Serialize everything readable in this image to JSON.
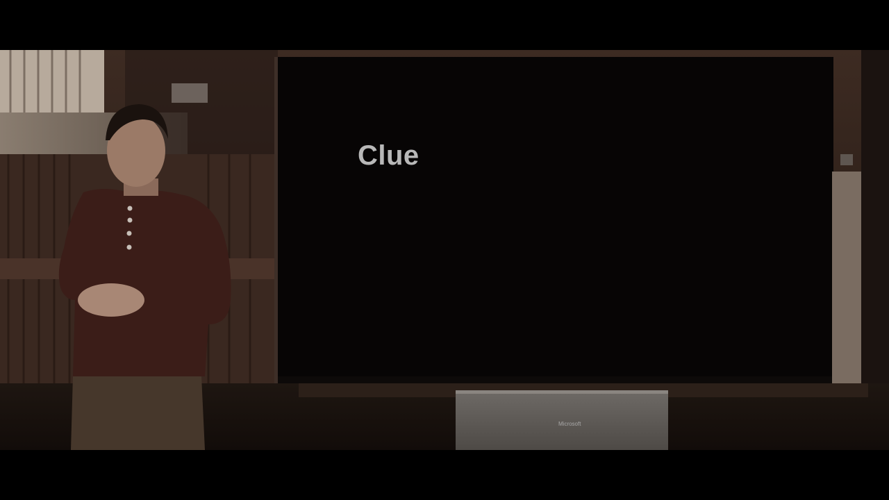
{
  "slide": {
    "title": "Clue"
  },
  "display": {
    "brand": "Microsoft"
  },
  "colors": {
    "letterbox": "#000000",
    "screen": "#070505",
    "title_text": "#b8b8b8",
    "sweater": "#3b1d18",
    "wall_wood": "#3a2820"
  }
}
